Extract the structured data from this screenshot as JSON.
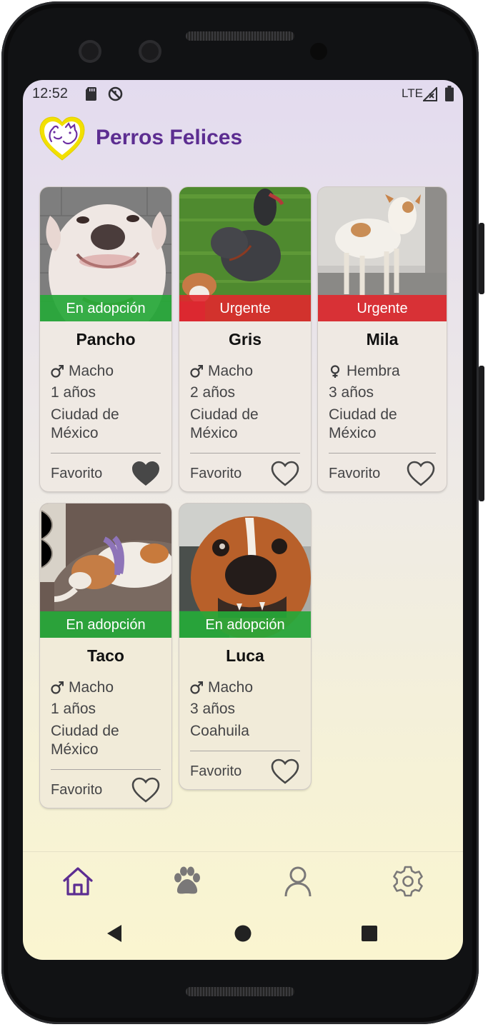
{
  "status_bar": {
    "time": "12:52",
    "network": "LTE"
  },
  "app": {
    "title": "Perros Felices",
    "brand_color": "#5c2d91"
  },
  "pets": [
    {
      "name": "Pancho",
      "status": "En adopción",
      "status_color": "green",
      "sex": "Macho",
      "age": "1 años",
      "location": "Ciudad de México",
      "favorite_label": "Favorito",
      "favorite": true
    },
    {
      "name": "Gris",
      "status": "Urgente",
      "status_color": "red",
      "sex": "Macho",
      "age": "2 años",
      "location": "Ciudad de México",
      "favorite_label": "Favorito",
      "favorite": false
    },
    {
      "name": "Mila",
      "status": "Urgente",
      "status_color": "red",
      "sex": "Hembra",
      "age": "3 años",
      "location": "Ciudad de México",
      "favorite_label": "Favorito",
      "favorite": false
    },
    {
      "name": "Taco",
      "status": "En adopción",
      "status_color": "green",
      "sex": "Macho",
      "age": "1 años",
      "location": "Ciudad de México",
      "favorite_label": "Favorito",
      "favorite": false
    },
    {
      "name": "Luca",
      "status": "En adopción",
      "status_color": "green",
      "sex": "Macho",
      "age": "3 años",
      "location": "Coahuila",
      "favorite_label": "Favorito",
      "favorite": false
    }
  ],
  "bottom_nav": [
    {
      "icon": "home-icon",
      "active": true
    },
    {
      "icon": "paw-icon",
      "active": false
    },
    {
      "icon": "profile-icon",
      "active": false
    },
    {
      "icon": "settings-icon",
      "active": false
    }
  ],
  "colors": {
    "adoption": "#26a838",
    "urgent": "#e0282e",
    "active_nav": "#5c2d91",
    "inactive_nav": "#7a7878"
  }
}
